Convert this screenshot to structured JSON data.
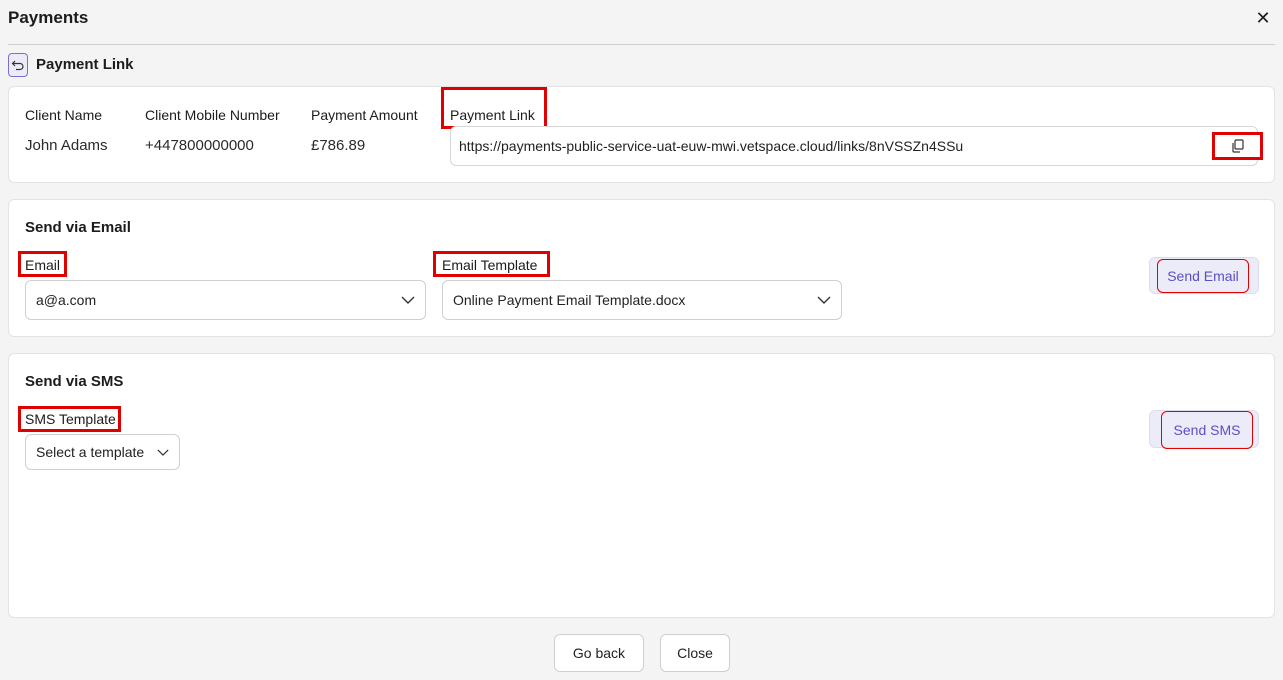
{
  "header": {
    "title": "Payments",
    "close_symbol": "✕"
  },
  "subheader": {
    "title": "Payment Link"
  },
  "details": {
    "client_name_label": "Client Name",
    "client_name_value": "John Adams",
    "client_mobile_label": "Client Mobile Number",
    "client_mobile_value": "+447800000000",
    "payment_amount_label": "Payment Amount",
    "payment_amount_value": "£786.89",
    "payment_link_label": "Payment Link",
    "payment_link_value": "https://payments-public-service-uat-euw-mwi.vetspace.cloud/links/8nVSSZn4SSu"
  },
  "email_section": {
    "title": "Send via Email",
    "email_label": "Email",
    "email_value": "a@a.com",
    "template_label": "Email Template",
    "template_value": "Online Payment Email Template.docx",
    "send_button": "Send Email"
  },
  "sms_section": {
    "title": "Send via SMS",
    "template_label": "SMS Template",
    "template_placeholder": "Select a template",
    "send_button": "Send SMS"
  },
  "footer": {
    "go_back": "Go back",
    "close": "Close"
  },
  "colors": {
    "accent": "#5a4fc4",
    "highlight": "#e00000"
  }
}
